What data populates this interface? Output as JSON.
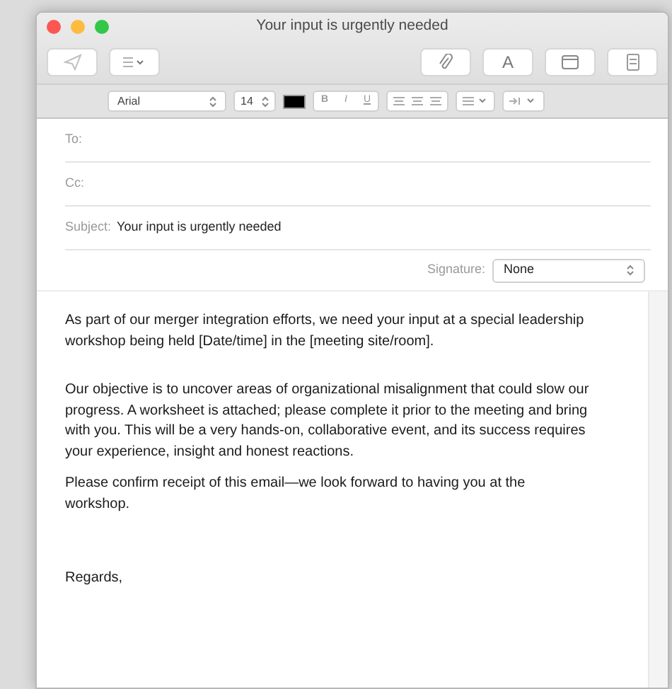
{
  "window": {
    "title": "Your input is urgently needed"
  },
  "toolbar": {
    "format_button": "A"
  },
  "format_bar": {
    "font": "Arial",
    "size": "14",
    "color": "#000000",
    "styles": [
      "B",
      "I",
      "U"
    ]
  },
  "fields": [
    {
      "label": "To:"
    },
    {
      "label": "Cc:"
    },
    {
      "label": "Subject:",
      "value": "Your input is urgently needed"
    }
  ],
  "signature": {
    "label": "Signature:",
    "value": "None"
  },
  "body": {
    "paragraphs": [
      "As part of our merger integration efforts, we need your input at a special leadership workshop being held [Date/time] in the [meeting site/room].",
      "Our objective is to uncover areas of organizational misalignment that could slow our progress. A worksheet is attached; please complete it prior to the meeting and bring with you. This will be a very hands-on, collaborative event, and its success requires your experience, insight and honest reactions.",
      "Please confirm receipt of this email—we look forward to having you at the workshop.",
      "Regards,"
    ]
  }
}
